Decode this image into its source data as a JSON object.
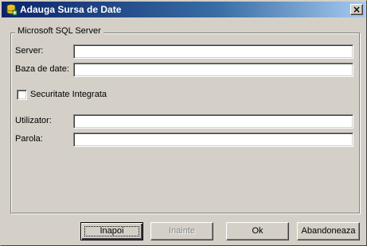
{
  "window": {
    "title": "Adauga Sursa de Date",
    "close_label": "×",
    "app_icon": "database-app-icon"
  },
  "group": {
    "legend": "Microsoft SQL Server"
  },
  "fields": {
    "server_label": "Server:",
    "server_value": "",
    "database_label": "Baza de date:",
    "database_value": "",
    "integrated_security_label": "Securitate Integrata",
    "integrated_security_checked": false,
    "user_label": "Utilizator:",
    "user_value": "",
    "password_label": "Parola:",
    "password_value": ""
  },
  "buttons": {
    "back_label": "Inapoi",
    "next_label": "Inainte",
    "ok_label": "Ok",
    "cancel_label": "Abandoneaza"
  },
  "colors": {
    "title_gradient_start": "#0a246a",
    "title_gradient_end": "#a6caf0",
    "dialog_face": "#d4d0c8"
  }
}
